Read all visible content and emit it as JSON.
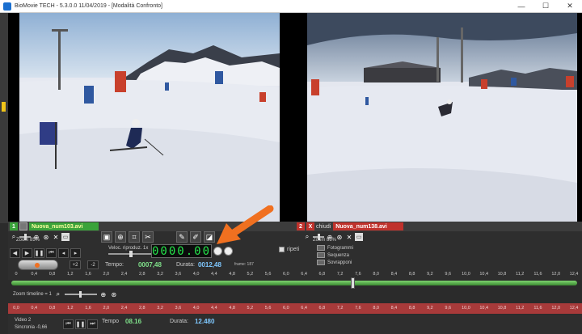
{
  "window": {
    "title": "BioMovie TECH - 5.3.0.0  11/04/2019 - [Modalità Confronto]",
    "minimize": "—",
    "maximize": "☐",
    "close": "✕"
  },
  "left_clip": {
    "number": "1",
    "filename": "Nuova_num103.avi",
    "zoom": "Zoom 85%"
  },
  "right_clip": {
    "number": "2",
    "close_mark": "X",
    "close_label": "chiudi",
    "filename": "Nuova_num138.avi",
    "zoom": "Zoom 85%"
  },
  "controls": {
    "speed_label": "Veloc. riproduz. 1x",
    "lcd_value": "0000.00",
    "ripeti": "ripeti",
    "step_plus": "+2",
    "step_minus": "-2",
    "tempo_label": "Tempo:",
    "tempo_value": "0007,48",
    "durata_label": "Durata:",
    "durata_value": "0012,48",
    "frame": "frame: 187",
    "modes": [
      "Fotogrammi",
      "Sequenza",
      "Sovrapponi"
    ]
  },
  "timeline": {
    "ticks": [
      "0",
      "0,4",
      "0,8",
      "1,2",
      "1,6",
      "2,0",
      "2,4",
      "2,8",
      "3,2",
      "3,6",
      "4,0",
      "4,4",
      "4,8",
      "5,2",
      "5,6",
      "6,0",
      "6,4",
      "6,8",
      "7,2",
      "7,6",
      "8,0",
      "8,4",
      "8,8",
      "9,2",
      "9,6",
      "10,0",
      "10,4",
      "10,8",
      "11,2",
      "11,6",
      "12,0",
      "12,4"
    ],
    "position": 0.6,
    "zoom_label": "Zoom timeline = 1",
    "red_ticks": [
      "0,0",
      "0,4",
      "0,8",
      "1,2",
      "1,6",
      "2,0",
      "2,4",
      "2,8",
      "3,2",
      "3,6",
      "4,0",
      "4,4",
      "4,8",
      "5,2",
      "5,6",
      "6,0",
      "6,4",
      "6,8",
      "7,2",
      "7,6",
      "8,0",
      "8,4",
      "8,8",
      "9,2",
      "9,6",
      "10,0",
      "10,4",
      "10,8",
      "11,2",
      "11,6",
      "12,0",
      "12,4"
    ]
  },
  "bottom": {
    "video_label": "Video 2",
    "sync_label": "Sincronia -0,66",
    "tempo_label": "Tempo",
    "tempo_value": "08.16",
    "durata_label": "Durata:",
    "durata_value": "12.480"
  }
}
